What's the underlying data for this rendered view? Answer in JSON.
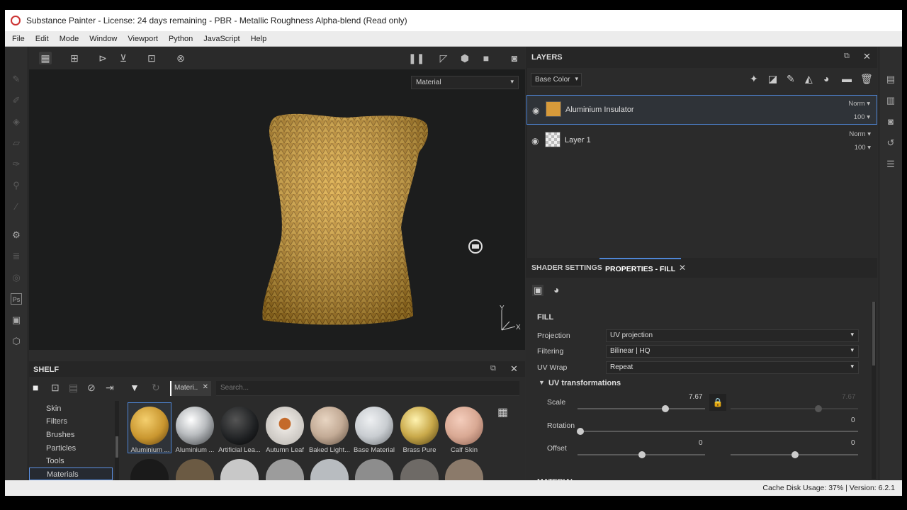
{
  "window": {
    "title": "Substance Painter - License: 24 days remaining - PBR - Metallic Roughness Alpha-blend (Read only)"
  },
  "menu": [
    "File",
    "Edit",
    "Mode",
    "Window",
    "Viewport",
    "Python",
    "JavaScript",
    "Help"
  ],
  "viewport": {
    "display_mode": "Material",
    "axis_x": "X",
    "axis_y": "Y"
  },
  "shelf": {
    "title": "SHELF",
    "filter_chip": "Materi..",
    "search_placeholder": "Search...",
    "categories": [
      {
        "label": "Skin",
        "selected": false
      },
      {
        "label": "Filters",
        "selected": false
      },
      {
        "label": "Brushes",
        "selected": false
      },
      {
        "label": "Particles",
        "selected": false
      },
      {
        "label": "Tools",
        "selected": false
      },
      {
        "label": "Materials",
        "selected": true
      }
    ],
    "materials": [
      {
        "label": "Aluminium ...",
        "color": "#c9962f",
        "selected": true
      },
      {
        "label": "Aluminium ...",
        "color": "#b9bcbf",
        "selected": false
      },
      {
        "label": "Artificial Lea...",
        "color": "#1d1f21",
        "selected": false
      },
      {
        "label": "Autumn Leaf",
        "color": "#d8d4cf",
        "selected": false
      },
      {
        "label": "Baked Light...",
        "color": "#c3ab96",
        "selected": false
      },
      {
        "label": "Base Material",
        "color": "#c9cdd1",
        "selected": false
      },
      {
        "label": "Brass Pure",
        "color": "#c9a94a",
        "selected": false
      },
      {
        "label": "Calf Skin",
        "color": "#d9a994",
        "selected": false
      }
    ]
  },
  "layers": {
    "title": "LAYERS",
    "channel": "Base Color",
    "items": [
      {
        "name": "Aluminium Insulator",
        "blend": "Norm",
        "opacity": "100",
        "swatch": "#d79a3a",
        "selected": true
      },
      {
        "name": "Layer 1",
        "blend": "Norm",
        "opacity": "100",
        "swatch": "checker",
        "selected": false
      }
    ]
  },
  "properties": {
    "tabs": [
      "SHADER SETTINGS",
      "PROPERTIES - FILL"
    ],
    "section": "FILL",
    "fields": [
      {
        "label": "Projection",
        "value": "UV projection"
      },
      {
        "label": "Filtering",
        "value": "Bilinear | HQ"
      },
      {
        "label": "UV Wrap",
        "value": "Repeat"
      }
    ],
    "uv_section": "UV transformations",
    "scale_label": "Scale",
    "scale_value": "7.67",
    "scale_value_locked": "7.67",
    "rotation_label": "Rotation",
    "rotation_value": "0",
    "offset_label": "Offset",
    "offset_u": "0",
    "offset_v": "0",
    "cut_section": "MATERIAL"
  },
  "status": {
    "text": "Cache Disk Usage:  37% | Version: 6.2.1"
  }
}
